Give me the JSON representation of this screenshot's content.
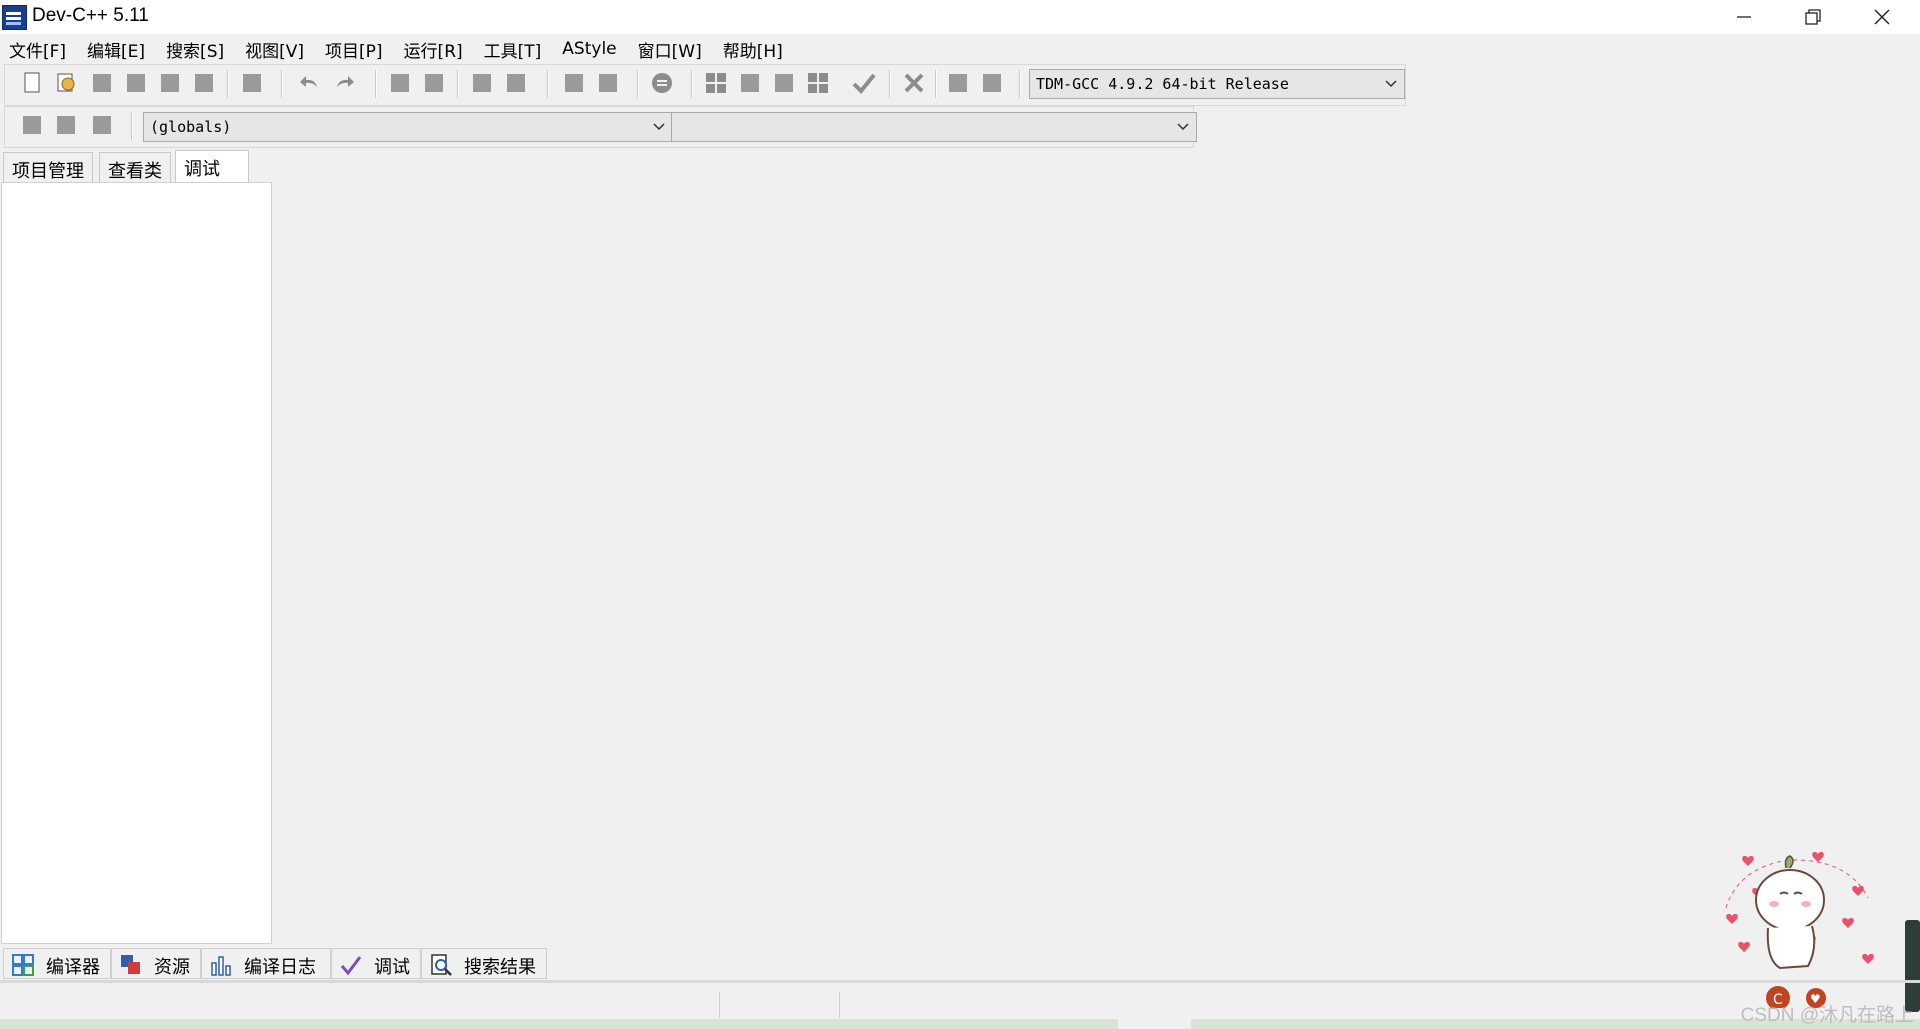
{
  "window": {
    "title": "Dev-C++ 5.11"
  },
  "menu": [
    "文件[F]",
    "编辑[E]",
    "搜索[S]",
    "视图[V]",
    "项目[P]",
    "运行[R]",
    "工具[T]",
    "AStyle",
    "窗口[W]",
    "帮助[H]"
  ],
  "toolbar": {
    "compiler_select": "TDM-GCC 4.9.2 64-bit Release",
    "scope_select": "(globals)",
    "member_select": ""
  },
  "left_tabs": [
    {
      "label": "项目管理",
      "active": false
    },
    {
      "label": "查看类",
      "active": false
    },
    {
      "label": "调试",
      "active": true
    }
  ],
  "bottom_tabs": [
    {
      "label": "编译器",
      "icon": "grid-icon"
    },
    {
      "label": "资源",
      "icon": "resources-icon"
    },
    {
      "label": "编译日志",
      "icon": "bar-chart-icon"
    },
    {
      "label": "调试",
      "icon": "check-icon"
    },
    {
      "label": "搜索结果",
      "icon": "search-doc-icon"
    }
  ],
  "watermark": "CSDN @沐凡在路上",
  "colors": {
    "title_bg": "#ffffff",
    "app_bg": "#f0f0f0",
    "panel_bg": "#ffffff",
    "heart": "#e8536b"
  }
}
